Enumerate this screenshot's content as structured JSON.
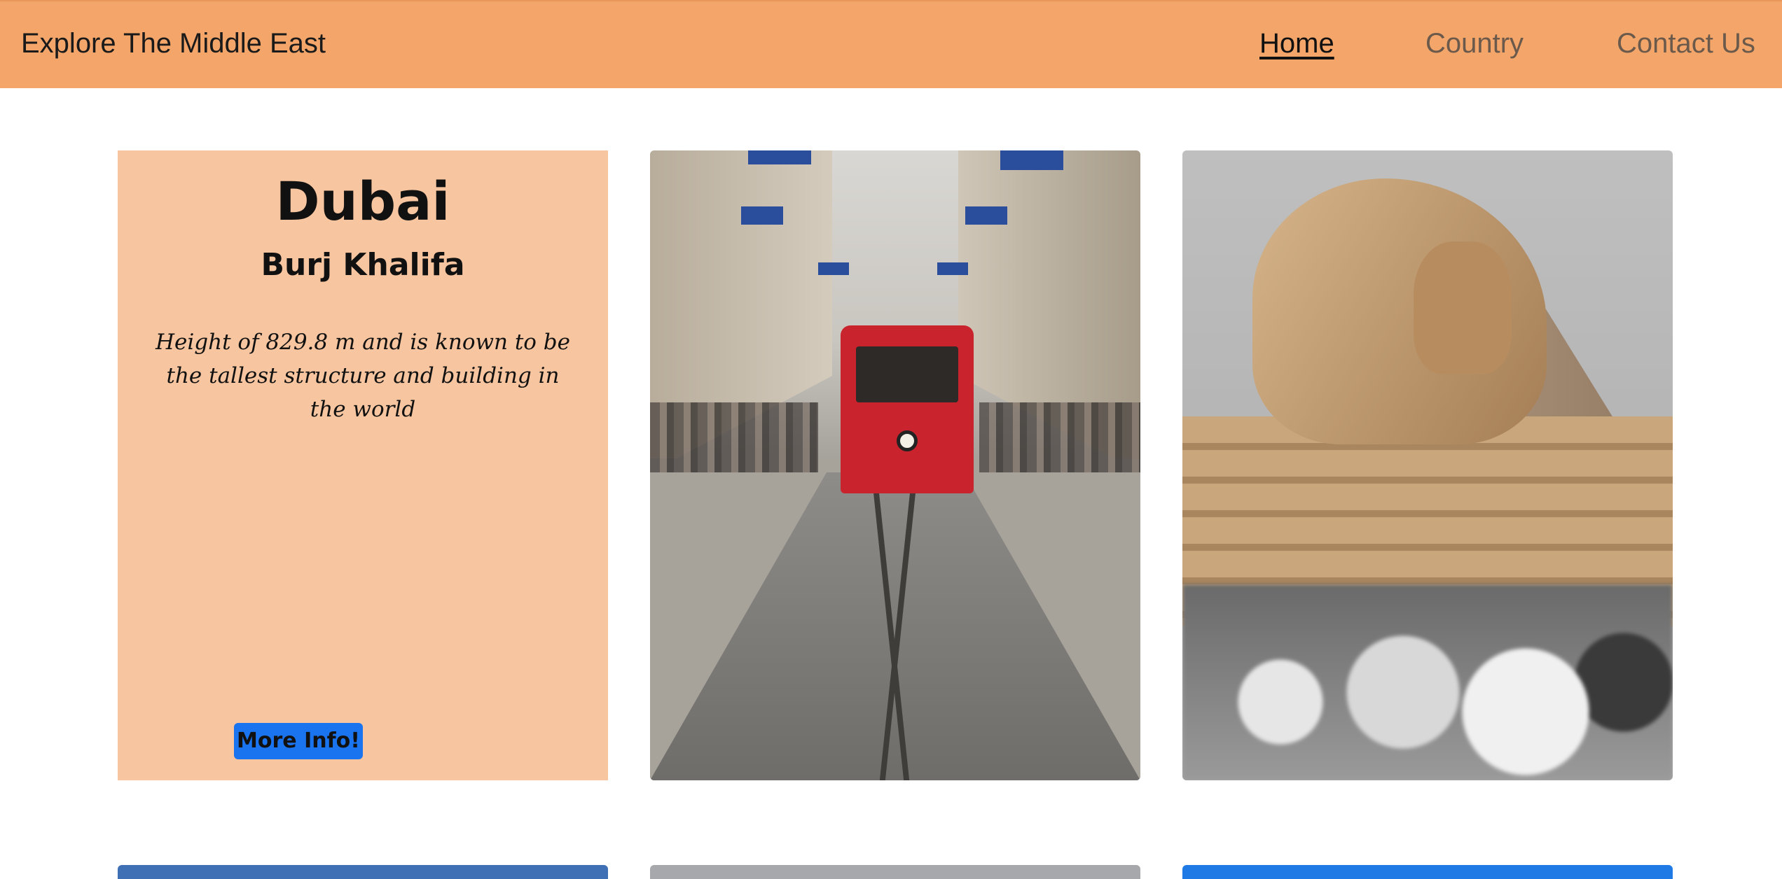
{
  "navbar": {
    "brand": "Explore The Middle East",
    "links": {
      "home": "Home",
      "country": "Country",
      "contact": "Contact Us"
    },
    "background": "#f4a66a"
  },
  "cards": {
    "info": {
      "title": "Dubai",
      "subtitle": "Burj Khalifa",
      "description": "Height of 829.8 m and is known to be the tallest structure and building in the world",
      "button_label": "More Info!",
      "background": "#f7c59f",
      "button_color": "#1a74f0"
    },
    "photos": [
      {
        "subject": "tram-street-photo"
      },
      {
        "subject": "sphinx-photo"
      }
    ]
  }
}
